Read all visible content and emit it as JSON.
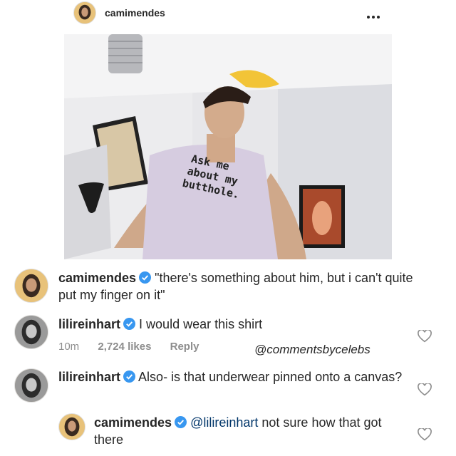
{
  "post": {
    "username": "camimendes",
    "more_icon": "more-horizontal-icon",
    "photo": {
      "shirt_text": [
        "Ask me",
        "about my",
        "butthole."
      ]
    }
  },
  "comments": [
    {
      "username": "camimendes",
      "verified": true,
      "text": "\"there's something about him, but i can't quite put my finger on it\""
    },
    {
      "username": "lilireinhart",
      "verified": true,
      "text": "I would wear this shirt",
      "time": "10m",
      "likes": "2,724 likes",
      "reply_label": "Reply",
      "heart_icon": "heart-outline-icon"
    },
    {
      "username": "lilireinhart",
      "verified": true,
      "text": "Also- is that underwear pinned onto a canvas?",
      "heart_icon": "heart-outline-icon"
    },
    {
      "username": "camimendes",
      "verified": true,
      "mention": "@lilireinhart",
      "text": "not sure how that got there",
      "heart_icon": "heart-outline-icon"
    }
  ],
  "watermark": "@commentsbycelebs",
  "colors": {
    "verified_blue": "#3897f0",
    "link_blue": "#003569",
    "meta_gray": "#8e8e8e"
  }
}
